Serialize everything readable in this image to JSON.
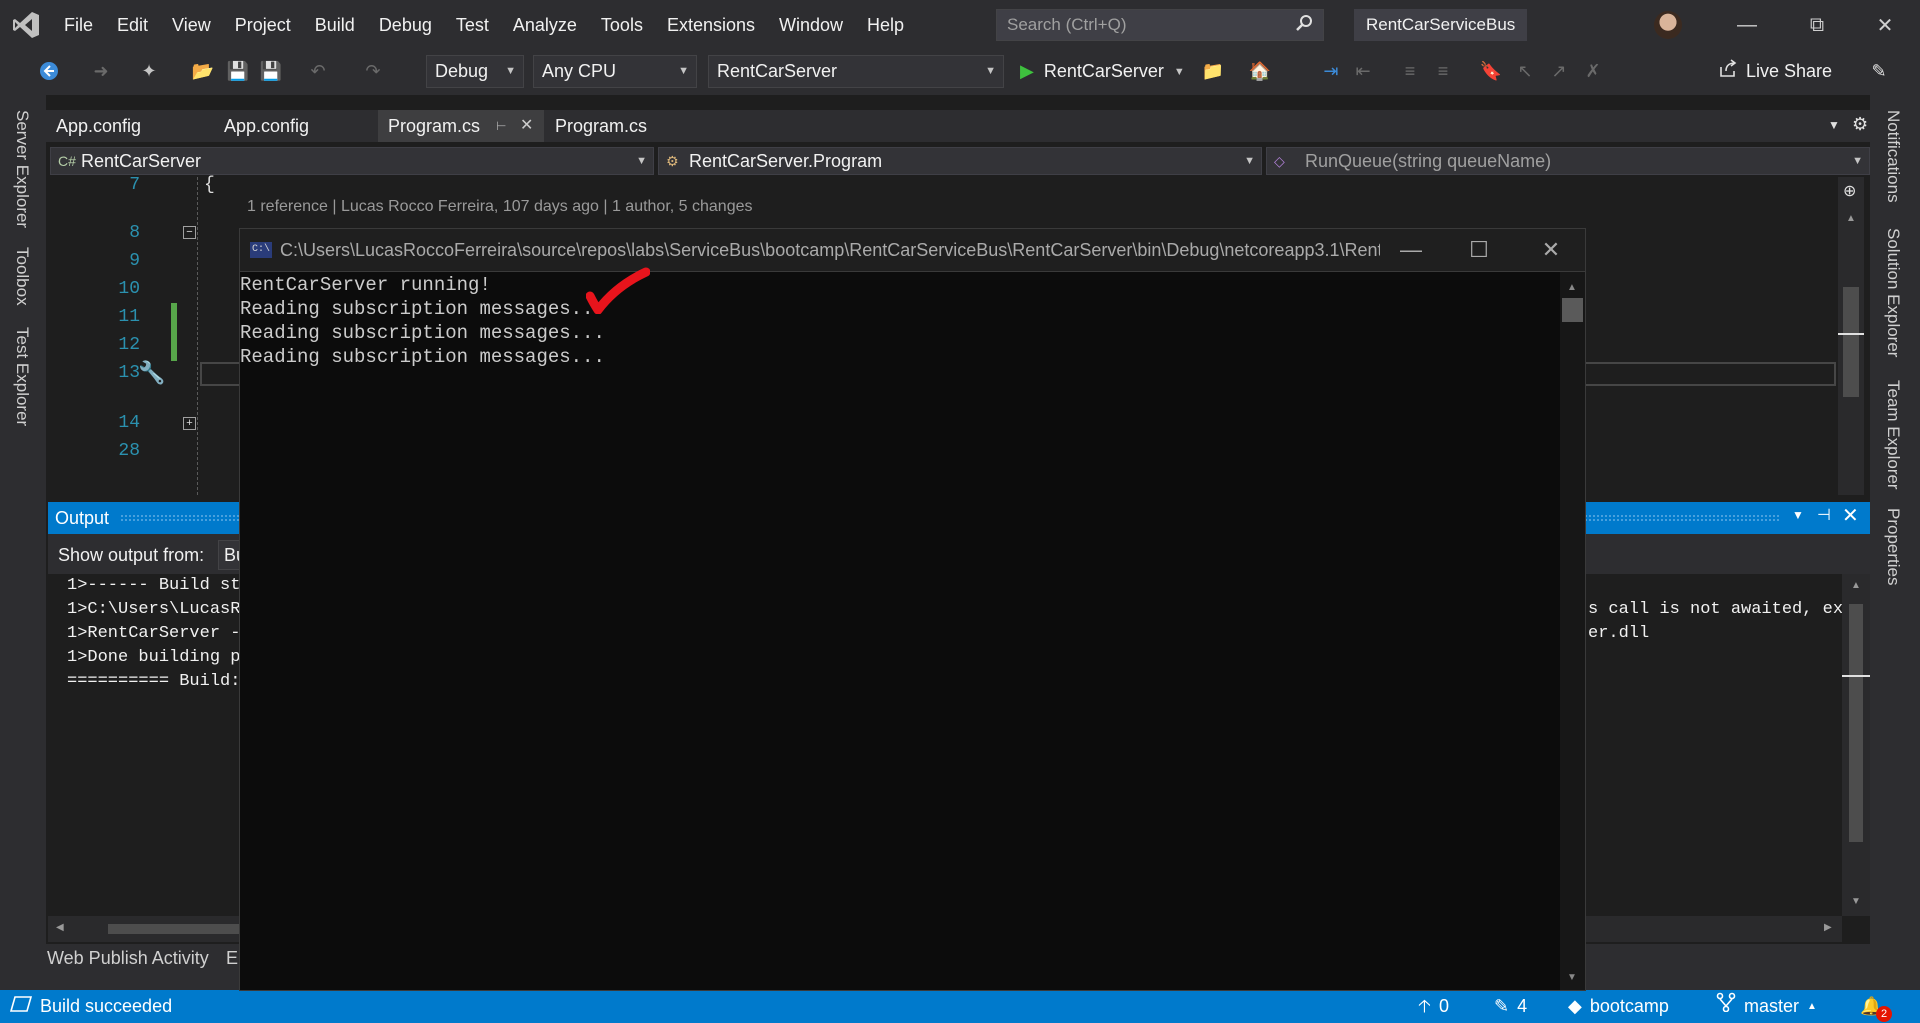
{
  "menubar": {
    "items": [
      "File",
      "Edit",
      "View",
      "Project",
      "Build",
      "Debug",
      "Test",
      "Analyze",
      "Tools",
      "Extensions",
      "Window",
      "Help"
    ],
    "search_placeholder": "Search (Ctrl+Q)",
    "solution_name": "RentCarServiceBus"
  },
  "toolbar": {
    "configuration": "Debug",
    "platform": "Any CPU",
    "startup_project": "RentCarServer",
    "start_label": "RentCarServer",
    "live_share": "Live Share"
  },
  "left_strip": {
    "tabs": [
      "Server Explorer",
      "Toolbox",
      "Test Explorer"
    ]
  },
  "right_strip": {
    "tabs": [
      "Notifications",
      "Solution Explorer",
      "Team Explorer",
      "Properties"
    ]
  },
  "doc_tabs": [
    "App.config",
    "App.config",
    "Program.cs",
    "Program.cs"
  ],
  "navbar": {
    "project": "RentCarServer",
    "type": "RentCarServer.Program",
    "member": "RunQueue(string queueName)"
  },
  "editor": {
    "line_numbers": [
      "7",
      "8",
      "9",
      "10",
      "11",
      "12",
      "13",
      "14",
      "28"
    ],
    "first_line_text": "{",
    "codelens": "1 reference | Lucas Rocco Ferreira, 107 days ago | 1 author, 5 changes"
  },
  "output": {
    "title": "Output",
    "show_from_label": "Show output from:",
    "source_value": "Build",
    "lines": [
      "1>------ Build st",
      "1>C:\\Users\\LucasRo",
      "1>RentCarServer -",
      "1>Done building p",
      "========== Build:"
    ],
    "right_fragments": [
      "s call is not awaited, exe",
      "er.dll"
    ]
  },
  "bottom_tabs": [
    "Web Publish Activity",
    "Er"
  ],
  "statusbar": {
    "message": "Build succeeded",
    "publish_count": "0",
    "changes_count": "4",
    "repo": "bootcamp",
    "branch": "master",
    "notifications": "2"
  },
  "console": {
    "title": "C:\\Users\\LucasRoccoFerreira\\source\\repos\\labs\\ServiceBus\\bootcamp\\RentCarServiceBus\\RentCarServer\\bin\\Debug\\netcoreapp3.1\\Rent...",
    "lines": [
      "RentCarServer running!",
      "Reading subscription messages...",
      "Reading subscription messages...",
      "Reading subscription messages..."
    ]
  },
  "colors": {
    "accent": "#007acc",
    "chrome": "#2d2d30",
    "editor_bg": "#1e1e1e",
    "console_bg": "#0c0c0c",
    "annotation_red": "#e8141c"
  }
}
